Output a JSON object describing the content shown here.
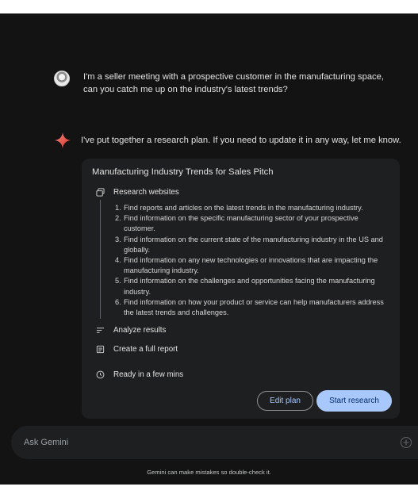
{
  "chat": {
    "user_message": "I'm a seller meeting with a prospective customer in the manufacturing space, can you catch me up on the industry's latest trends?",
    "assistant_message": "I've put together a research plan. If you need to update it in any way, let me know."
  },
  "plan": {
    "title": "Manufacturing Industry Trends for Sales Pitch",
    "steps": {
      "research": {
        "label": "Research websites",
        "icon": "web-icon"
      },
      "analyze": {
        "label": "Analyze results",
        "icon": "list-icon"
      },
      "report": {
        "label": "Create a full report",
        "icon": "document-icon"
      },
      "ready": {
        "label": "Ready in a few mins",
        "icon": "clock-icon"
      }
    },
    "tasks": [
      {
        "num": "1.",
        "text": "Find reports and articles on the latest trends in the manufacturing industry."
      },
      {
        "num": "2.",
        "text": "Find information on the specific manufacturing sector of your prospective customer."
      },
      {
        "num": "3.",
        "text": "Find information on the current state of the manufacturing industry in the US and globally."
      },
      {
        "num": "4.",
        "text": "Find information on any new technologies or innovations that are impacting the manufacturing industry."
      },
      {
        "num": "5.",
        "text": "Find information on the challenges and opportunities facing the manufacturing industry."
      },
      {
        "num": "6.",
        "text": "Find information on how your product or service can help manufacturers address the latest trends and challenges."
      }
    ],
    "edit_label": "Edit plan",
    "start_label": "Start research"
  },
  "input": {
    "placeholder": "Ask Gemini"
  },
  "footer": {
    "disclaimer": "Gemini can make mistakes so double-check it."
  },
  "colors": {
    "background": "#131314",
    "card": "#1e1f20",
    "accent": "#a8c7fa",
    "spark": "#e8605a"
  }
}
